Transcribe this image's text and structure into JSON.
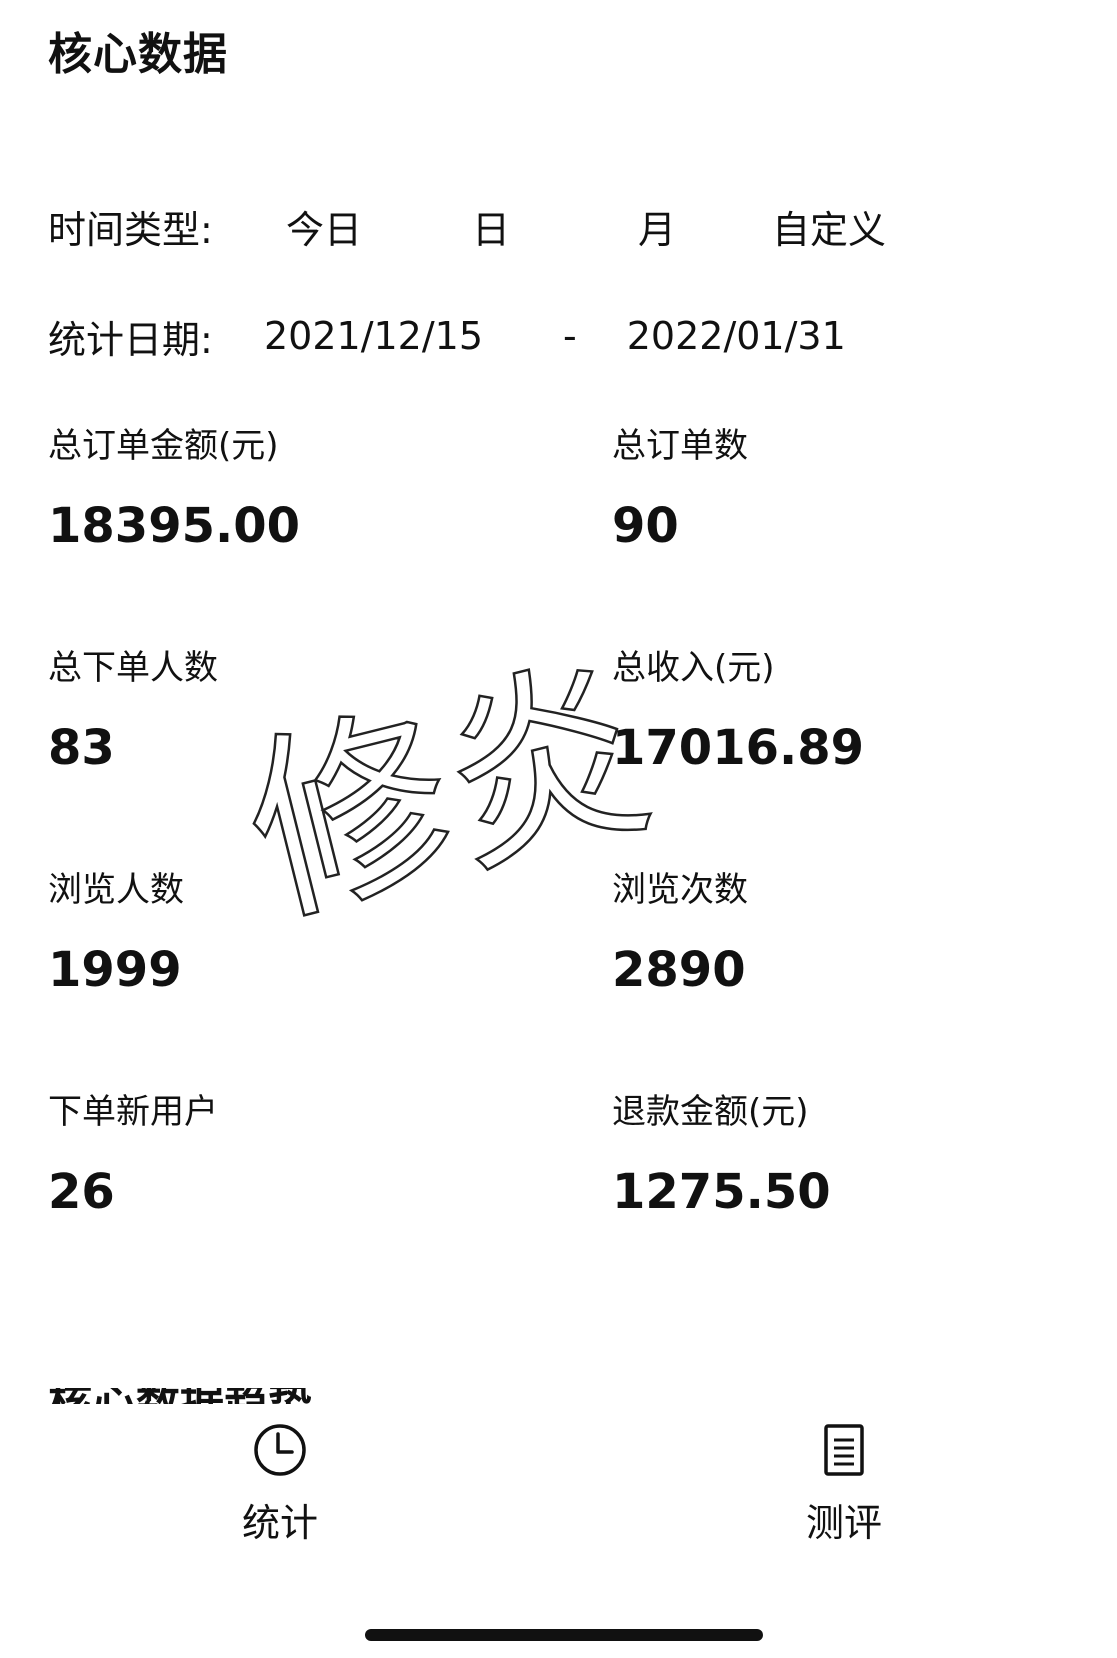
{
  "page": {
    "title": "核心数据",
    "next_section_title": "核心数据趋势"
  },
  "filters": {
    "time_type_label": "时间类型:",
    "time_options": [
      "今日",
      "日",
      "月",
      "自定义"
    ],
    "date_label": "统计日期:",
    "start_date": "2021/12/15",
    "separator": "-",
    "end_date": "2022/01/31"
  },
  "metrics": [
    {
      "label": "总订单金额(元)",
      "value": "18395.00"
    },
    {
      "label": "总订单数",
      "value": "90"
    },
    {
      "label": "总下单人数",
      "value": "83"
    },
    {
      "label": "总收入(元)",
      "value": "17016.89"
    },
    {
      "label": "浏览人数",
      "value": "1999"
    },
    {
      "label": "浏览次数",
      "value": "2890"
    },
    {
      "label": "下单新用户",
      "value": "26"
    },
    {
      "label": "退款金额(元)",
      "value": "1275.50"
    }
  ],
  "tabbar": {
    "tabs": [
      {
        "label": "统计",
        "icon": "clock-icon"
      },
      {
        "label": "测评",
        "icon": "document-list-icon"
      }
    ]
  },
  "watermark": {
    "text": "修炎"
  }
}
